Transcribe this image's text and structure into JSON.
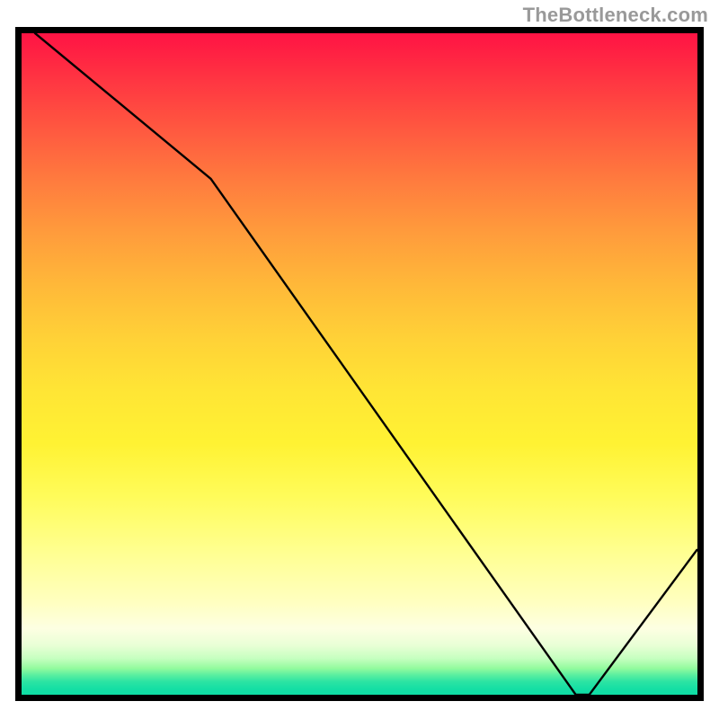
{
  "watermark": "TheBottleneck.com",
  "bottom_marker": "",
  "chart_data": {
    "type": "line",
    "title": "",
    "xlabel": "",
    "ylabel": "",
    "xlim": [
      0,
      100
    ],
    "ylim": [
      0,
      100
    ],
    "x": [
      0,
      2,
      28,
      82,
      84,
      100
    ],
    "values": [
      103,
      100,
      78,
      0,
      0,
      22
    ],
    "notes": "Decreasing black curve with a minimum near x≈82–84 then rising; background is red→yellow→green vertical gradient. Values are estimates of vertical position as % from bottom of plot."
  },
  "colors": {
    "frame": "#000000",
    "line": "#000000",
    "watermark": "#999999",
    "marker": "#d23c28"
  }
}
